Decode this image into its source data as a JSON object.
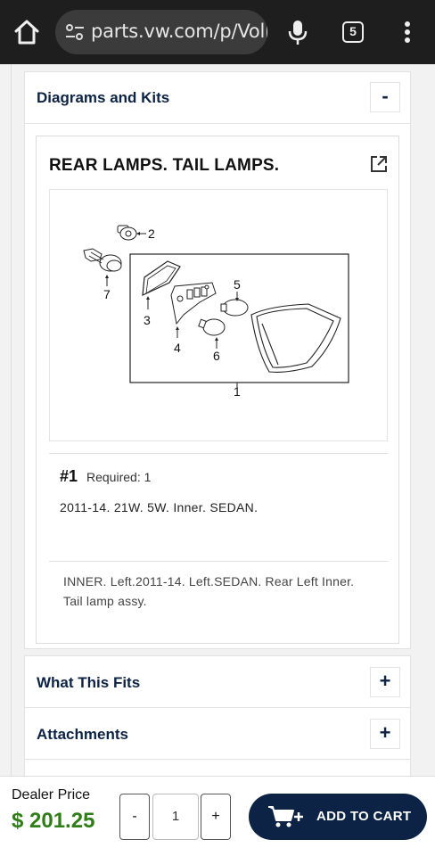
{
  "browser": {
    "url": "parts.vw.com/p/Volks",
    "tab_count": "5",
    "icons": [
      "home-icon",
      "site-settings-icon",
      "microphone-icon",
      "tab-switcher-icon",
      "more-vert-icon"
    ]
  },
  "sections": {
    "diagrams": {
      "title": "Diagrams and Kits",
      "toggle": "-"
    },
    "fits": {
      "title": "What This Fits",
      "toggle": "+"
    },
    "attachments": {
      "title": "Attachments",
      "toggle": "+"
    }
  },
  "diagram": {
    "title": "REAR LAMPS. TAIL LAMPS.",
    "callouts": [
      "1",
      "2",
      "3",
      "4",
      "5",
      "6",
      "7"
    ]
  },
  "part": {
    "ref": "#1",
    "required": "Required: 1",
    "variant": "2011-14. 21W. 5W. Inner. SEDAN.",
    "description": "INNER. Left.2011-14. Left.SEDAN. Rear Left Inner. Tail lamp assy."
  },
  "purchase": {
    "price_label": "Dealer Price",
    "price": "$ 201.25",
    "minus": "-",
    "quantity": "1",
    "plus": "+",
    "add_to_cart": "ADD TO CART"
  },
  "colors": {
    "navy": "#0d2345",
    "price_green": "#2e7d16",
    "browser_bar": "#1e1e1e"
  }
}
